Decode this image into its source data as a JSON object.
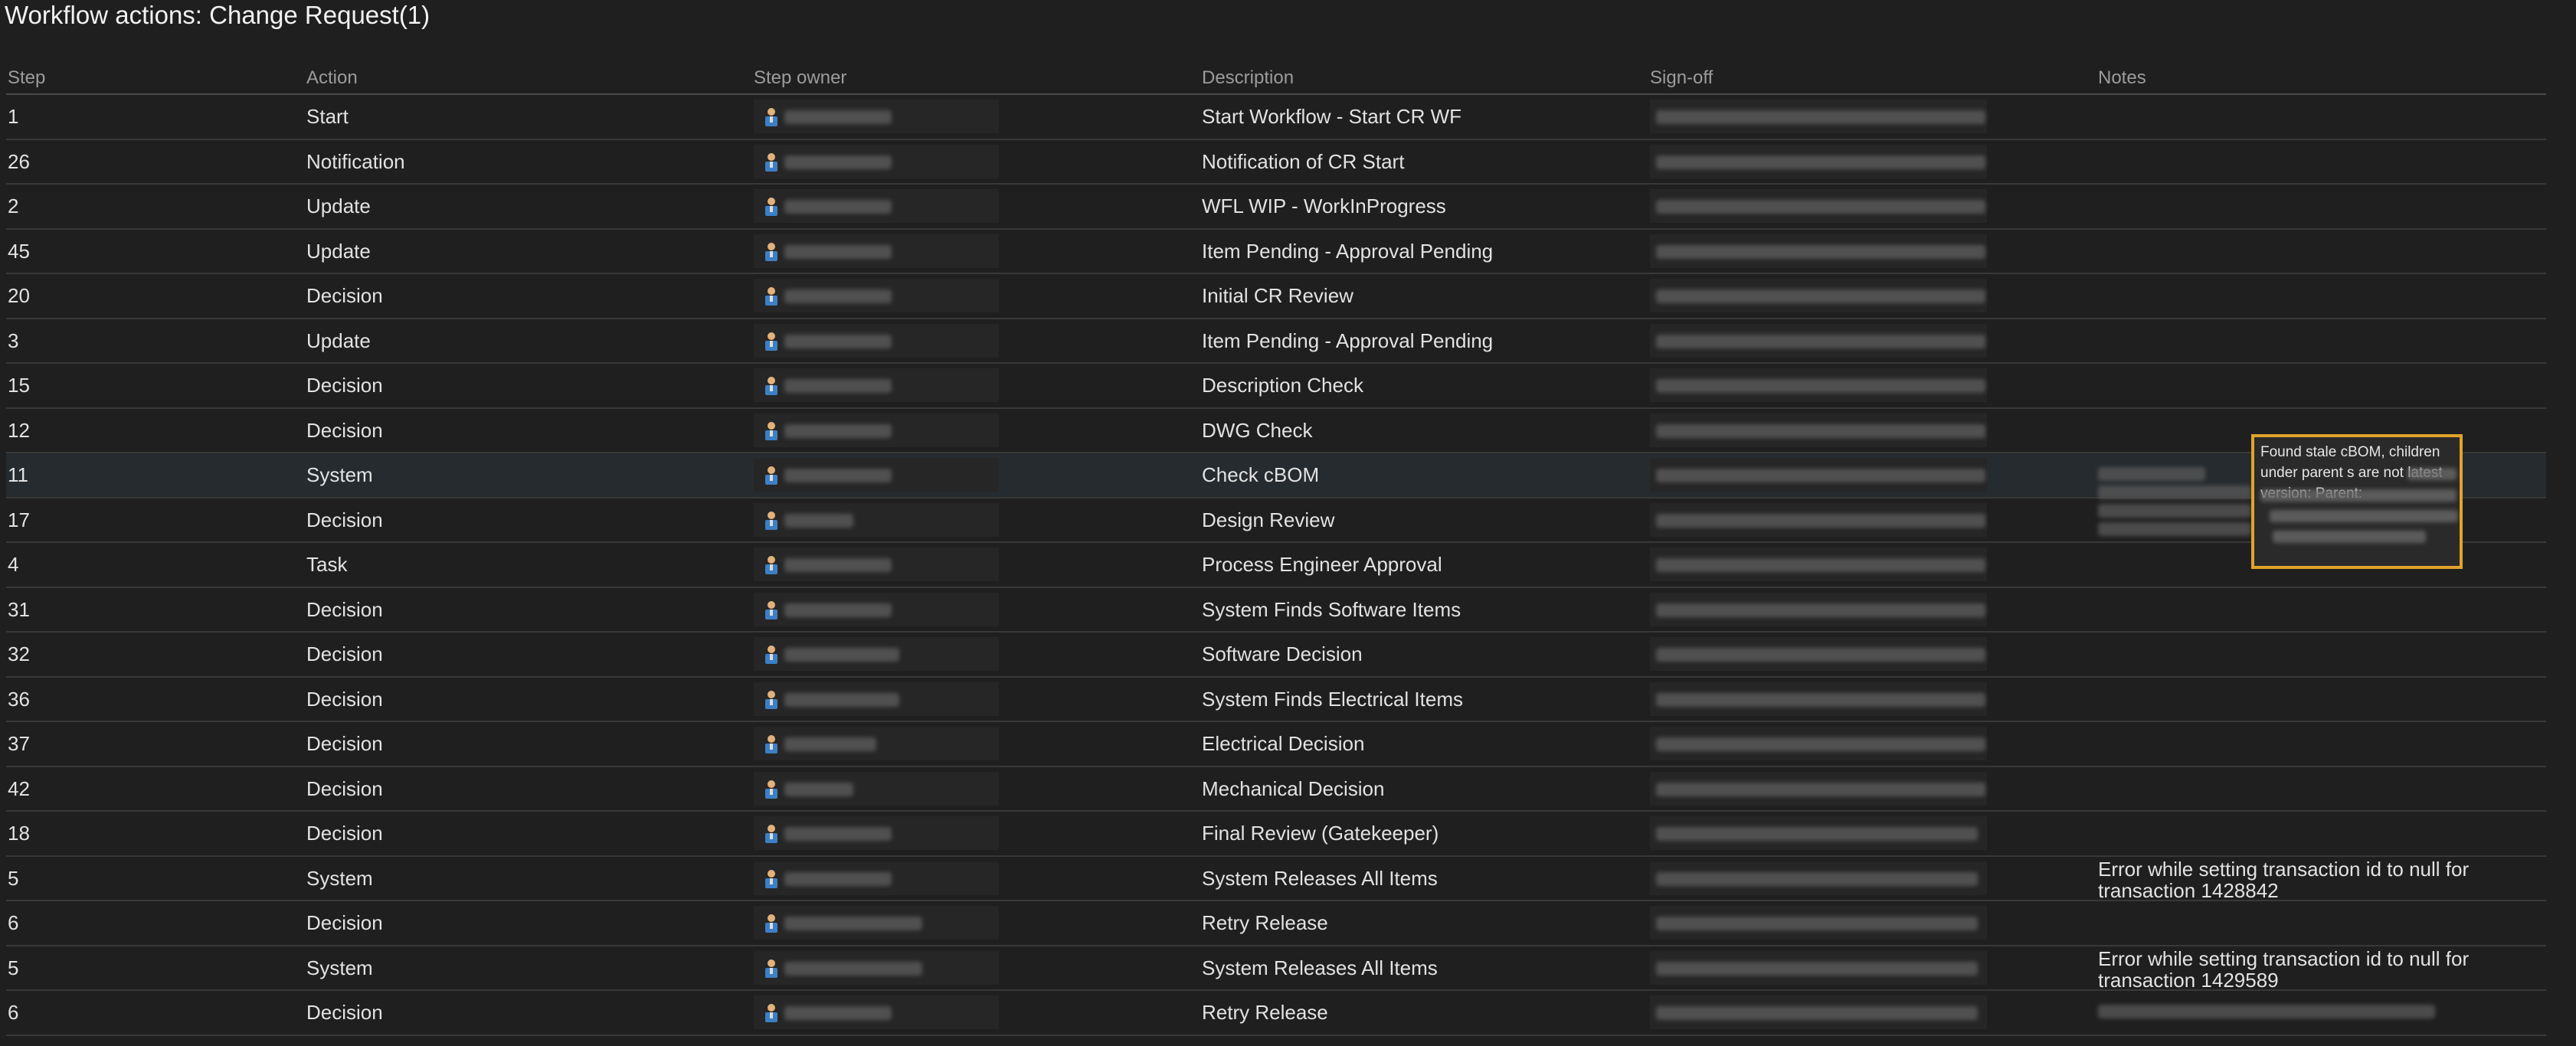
{
  "page": {
    "title": "Workflow actions: Change Request(1)"
  },
  "table": {
    "headers": {
      "step": "Step",
      "action": "Action",
      "owner": "Step owner",
      "description": "Description",
      "signoff": "Sign-off",
      "notes": "Notes"
    },
    "rows": [
      {
        "step": "1",
        "action": "Start",
        "description": "Start Workflow - Start CR WF",
        "notes": ""
      },
      {
        "step": "26",
        "action": "Notification",
        "description": "Notification of CR Start",
        "notes": ""
      },
      {
        "step": "2",
        "action": "Update",
        "description": "WFL WIP - WorkInProgress",
        "notes": ""
      },
      {
        "step": "45",
        "action": "Update",
        "description": "Item Pending - Approval Pending",
        "notes": ""
      },
      {
        "step": "20",
        "action": "Decision",
        "description": "Initial CR Review",
        "notes": ""
      },
      {
        "step": "3",
        "action": "Update",
        "description": "Item Pending - Approval Pending",
        "notes": ""
      },
      {
        "step": "15",
        "action": "Decision",
        "description": "Description Check",
        "notes": ""
      },
      {
        "step": "12",
        "action": "Decision",
        "description": "DWG Check",
        "notes": ""
      },
      {
        "step": "11",
        "action": "System",
        "description": "Check cBOM",
        "notes": ""
      },
      {
        "step": "17",
        "action": "Decision",
        "description": "Design Review",
        "notes": ""
      },
      {
        "step": "4",
        "action": "Task",
        "description": "Process Engineer Approval",
        "notes": ""
      },
      {
        "step": "31",
        "action": "Decision",
        "description": "System Finds Software Items",
        "notes": ""
      },
      {
        "step": "32",
        "action": "Decision",
        "description": "Software Decision",
        "notes": ""
      },
      {
        "step": "36",
        "action": "Decision",
        "description": "System Finds Electrical Items",
        "notes": ""
      },
      {
        "step": "37",
        "action": "Decision",
        "description": "Electrical Decision",
        "notes": ""
      },
      {
        "step": "42",
        "action": "Decision",
        "description": "Mechanical Decision",
        "notes": ""
      },
      {
        "step": "18",
        "action": "Decision",
        "description": "Final Review (Gatekeeper)",
        "notes": ""
      },
      {
        "step": "5",
        "action": "System",
        "description": "System Releases All Items",
        "notes": "Error while setting transaction id to null for transaction 1428842"
      },
      {
        "step": "6",
        "action": "Decision",
        "description": "Retry Release",
        "notes": ""
      },
      {
        "step": "5",
        "action": "System",
        "description": "System Releases All Items",
        "notes": "Error while setting transaction id to null for transaction 1429589"
      },
      {
        "step": "6",
        "action": "Decision",
        "description": "Retry Release",
        "notes": ""
      }
    ]
  },
  "tooltip": {
    "text": "Found stale cBOM, children under parent s are not latest version: Parent:"
  },
  "colors": {
    "background": "#1f1f1f",
    "highlight_row": "#262b2f",
    "tooltip_border": "#e0a32a"
  },
  "icons": {
    "step_owner": "person-icon"
  }
}
